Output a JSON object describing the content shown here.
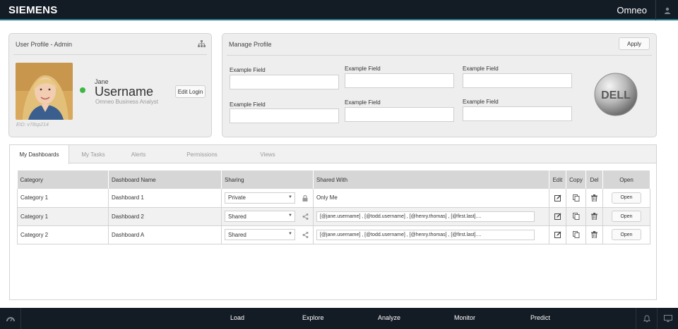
{
  "header": {
    "brand": "SIEMENS",
    "app_name": "Omneo",
    "icons": {
      "user": "user-icon"
    }
  },
  "profile": {
    "title": "User Profile - Admin",
    "first_name": "Jane",
    "username": "Username",
    "role": "Omneo Business Analyst",
    "eid": "EID: v78sp214",
    "edit_login_label": "Edit Login",
    "status_color": "#3db843",
    "icons": {
      "hierarchy": "org-chart-icon",
      "status": "online-status-dot"
    }
  },
  "manage": {
    "title": "Manage Profile",
    "apply_label": "Apply",
    "fields": [
      {
        "label": "Example Field",
        "value": ""
      },
      {
        "label": "Example Field",
        "value": ""
      },
      {
        "label": "Example Field",
        "value": ""
      },
      {
        "label": "Example Field",
        "value": ""
      },
      {
        "label": "Example Field",
        "value": ""
      },
      {
        "label": "Example Field",
        "value": ""
      }
    ],
    "logo_text": "DELL"
  },
  "tabs": [
    {
      "label": "My Dashboards",
      "active": true
    },
    {
      "label": "My Tasks",
      "active": false
    },
    {
      "label": "Alerts",
      "active": false
    },
    {
      "label": "Permissions",
      "active": false
    },
    {
      "label": "Views",
      "active": false
    }
  ],
  "table": {
    "columns": [
      "Category",
      "Dashboard Name",
      "Sharing",
      "Shared With",
      "Edit",
      "Copy",
      "Del",
      "Open"
    ],
    "rows": [
      {
        "category": "Category 1",
        "name": "Dashboard 1",
        "sharing": "Private",
        "shared_with": "Only Me",
        "open_label": "Open"
      },
      {
        "category": "Category 1",
        "name": "Dashboard 2",
        "sharing": "Shared",
        "shared_with": "[@jane.username] , [@todd.username] , [@henry.thomas] , [@first.last]....",
        "open_label": "Open"
      },
      {
        "category": "Category 2",
        "name": "Dashboard A",
        "sharing": "Shared",
        "shared_with": "[@jane.username] , [@todd.username] , [@henry.thomas] , [@first.last]....",
        "open_label": "Open"
      }
    ],
    "icons": {
      "edit": "edit-icon",
      "copy": "copy-icon",
      "delete": "trash-icon",
      "private": "lock-icon",
      "shared": "share-icon"
    }
  },
  "footer": {
    "nav": [
      "Load",
      "Explore",
      "Analyze",
      "Monitor",
      "Predict"
    ],
    "icons": {
      "left": "dashboard-gauge-icon",
      "notifications": "bell-icon",
      "screen": "monitor-icon"
    }
  },
  "colors": {
    "topbar": "#131b24",
    "accent_line": "#2a7f8f",
    "panel_bg": "#eeeeee"
  }
}
